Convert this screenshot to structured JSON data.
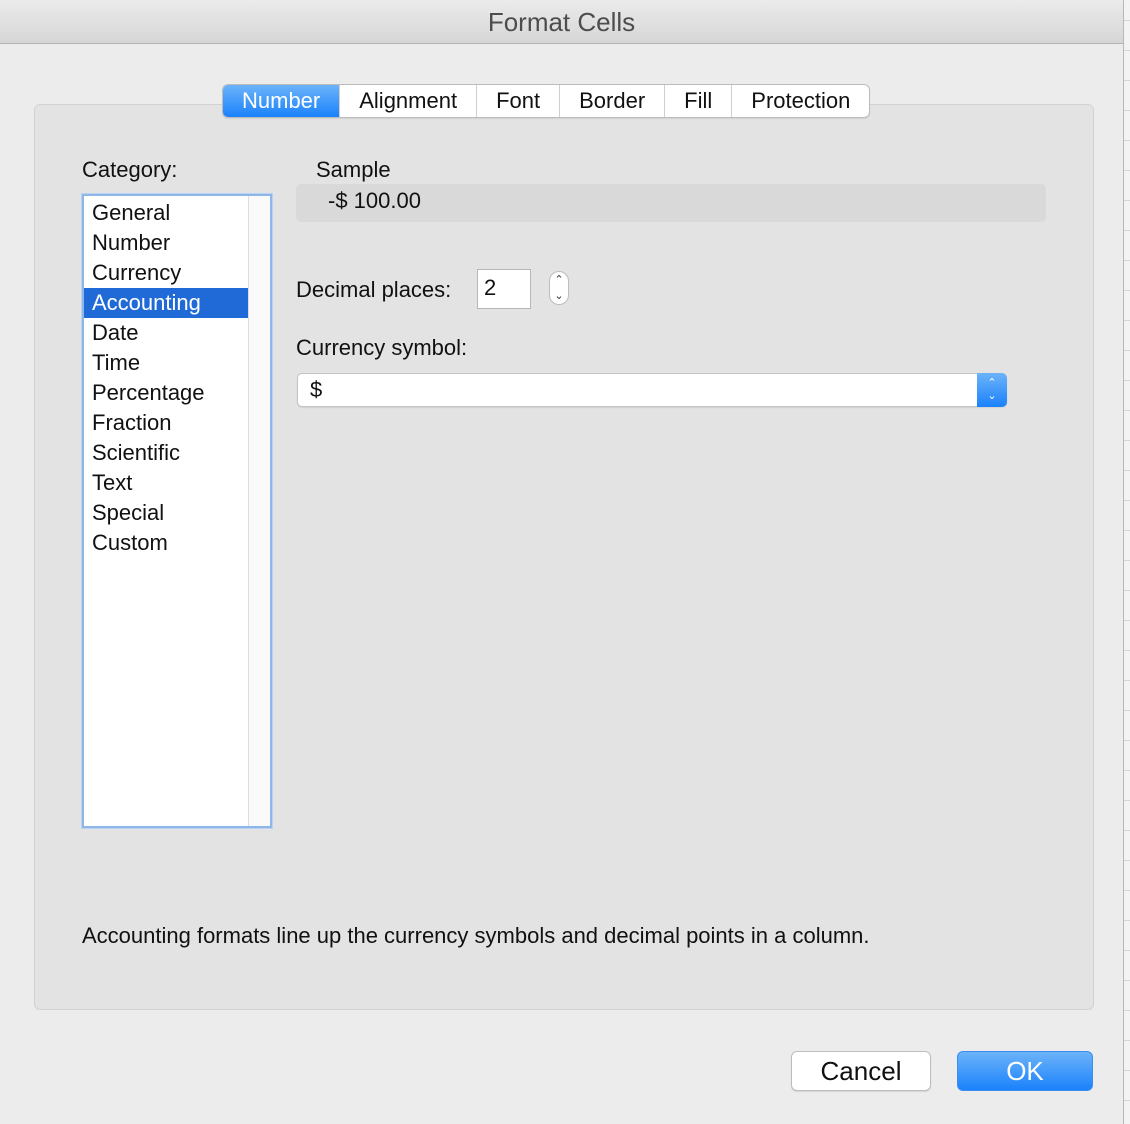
{
  "window": {
    "title": "Format Cells"
  },
  "tabs": [
    {
      "label": "Number",
      "active": true
    },
    {
      "label": "Alignment",
      "active": false
    },
    {
      "label": "Font",
      "active": false
    },
    {
      "label": "Border",
      "active": false
    },
    {
      "label": "Fill",
      "active": false
    },
    {
      "label": "Protection",
      "active": false
    }
  ],
  "category": {
    "label": "Category:",
    "items": [
      "General",
      "Number",
      "Currency",
      "Accounting",
      "Date",
      "Time",
      "Percentage",
      "Fraction",
      "Scientific",
      "Text",
      "Special",
      "Custom"
    ],
    "selected": "Accounting"
  },
  "sample": {
    "label": "Sample",
    "value": "-$ 100.00"
  },
  "decimal_places": {
    "label": "Decimal places:",
    "value": "2"
  },
  "currency_symbol": {
    "label": "Currency symbol:",
    "value": "$"
  },
  "description": "Accounting formats line up the currency symbols and decimal points in a column.",
  "buttons": {
    "cancel": "Cancel",
    "ok": "OK"
  },
  "colors": {
    "accent": "#1a82fb",
    "selection": "#1f6ad7"
  }
}
